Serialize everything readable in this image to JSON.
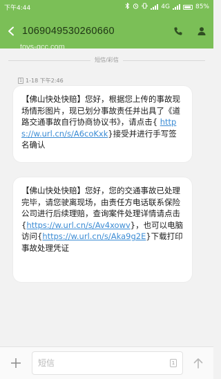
{
  "status_bar": {
    "time": "下午4:44",
    "network": "4G",
    "battery": "85%"
  },
  "header": {
    "back_icon": "chevron-left-icon",
    "title": "1069049530260660",
    "call_icon": "phone-icon",
    "contact_icon": "person-icon",
    "watermark": "toys-gcc.com"
  },
  "conversation": {
    "channel_label": "短信/彩信",
    "sim_badge": "1",
    "timestamp": "1-18 下午2:46",
    "messages": [
      {
        "text_1": "【佛山快处快赔】您好，根据您上传的事故现场情形图片，现已划分事故责任并出具了《道路交通事故自行协商协议书》，请点击{ ",
        "link_1": "https://w.url.cn/s/A6coKxk",
        "text_2": "}接受并进行手写签名确认"
      },
      {
        "text_1": "【佛山快处快赔】您好，您的交通事故已处理完毕，请您驶离现场，由责任方电话联系保险公司进行后续理赔，查询案件处理详情请点击{",
        "link_1": "https://w.url.cn/s/Av4xowv",
        "text_2": "}，也可以电脑访问{",
        "link_2": "https://w.url.cn/s/Aka9g2E",
        "text_3": "}下载打印事故处理凭证"
      }
    ]
  },
  "composer": {
    "add_icon": "plus-icon",
    "placeholder": "短信",
    "sim_selector": "1",
    "send_icon": "arrow-up-icon"
  },
  "colors": {
    "header_green": "#7bbf57",
    "link_blue": "#3a8bd4",
    "bubble_bg": "#ffffff",
    "page_bg": "#f2f2f2"
  }
}
